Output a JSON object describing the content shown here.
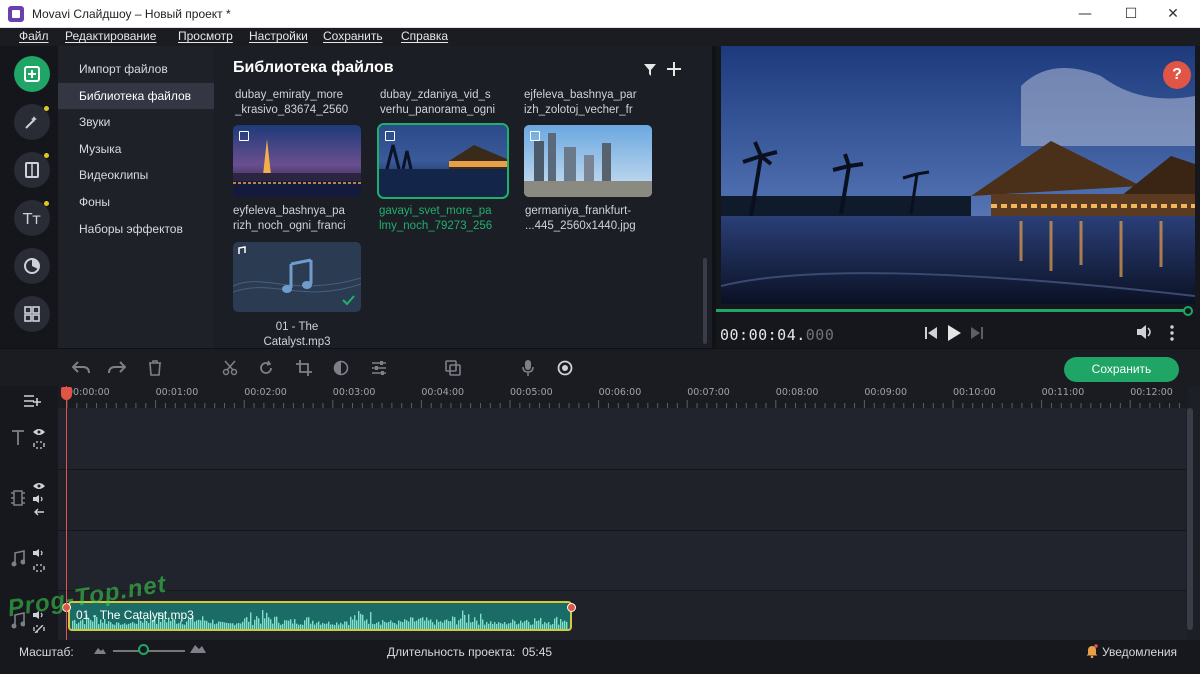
{
  "window": {
    "title": "Movavi Слайдшоу – Новый проект *",
    "minimize": "—",
    "maximize": "☐",
    "close": "✕"
  },
  "menu": [
    "Файл",
    "Редактирование",
    "Просмотр",
    "Настройки",
    "Сохранить",
    "Справка"
  ],
  "rail": [
    {
      "icon": "import-icon",
      "active": true
    },
    {
      "icon": "magic-wand-icon",
      "dot": true
    },
    {
      "icon": "transitions-icon",
      "dot": true
    },
    {
      "icon": "titles-icon",
      "dot": true
    },
    {
      "icon": "filters-icon"
    },
    {
      "icon": "grid-icon"
    }
  ],
  "categories": [
    "Импорт файлов",
    "Библиотека файлов",
    "Звуки",
    "Музыка",
    "Видеоклипы",
    "Фоны",
    "Наборы эффектов"
  ],
  "library": {
    "title": "Библиотека файлов",
    "top_row": [
      [
        "dubay_emiraty_more",
        "_krasivo_83674_2560"
      ],
      [
        "dubay_zdaniya_vid_s",
        "verhu_panorama_ogni"
      ],
      [
        "ejfeleva_bashnya_par",
        "izh_zolotoj_vecher_fr"
      ]
    ],
    "items": [
      {
        "line1": "eyfeleva_bashnya_pa",
        "line2": "rizh_noch_ogni_franci"
      },
      {
        "line1": "gavayi_svet_more_pa",
        "line2": "lmy_noch_79273_256",
        "selected": true
      },
      {
        "line1": "germaniya_frankfurt-",
        "line2": "...445_2560x1440.jpg"
      }
    ],
    "audio": {
      "line1": "01 - The",
      "line2": "Catalyst.mp3"
    }
  },
  "preview": {
    "help": "?",
    "timecode_main": "00:00:04.",
    "timecode_ms": "000"
  },
  "toolbar": {
    "save_label": "Сохранить"
  },
  "ruler": [
    "00:00:00",
    "00:01:00",
    "00:02:00",
    "00:03:00",
    "00:04:00",
    "00:05:00",
    "00:06:00",
    "00:07:00",
    "00:08:00",
    "00:09:00",
    "00:10:00",
    "00:11:00",
    "00:12:00"
  ],
  "clip": {
    "label": "01 - The Catalyst.mp3"
  },
  "status": {
    "scale_label": "Масштаб:",
    "duration_label": "Длительность проекта:",
    "duration_value": "05:45",
    "notifications": "Уведомления"
  },
  "watermark": "Prog-Top.net",
  "colors": {
    "accent": "#1fa565",
    "playhead": "#e05545",
    "clip_border": "#d8c83a"
  }
}
